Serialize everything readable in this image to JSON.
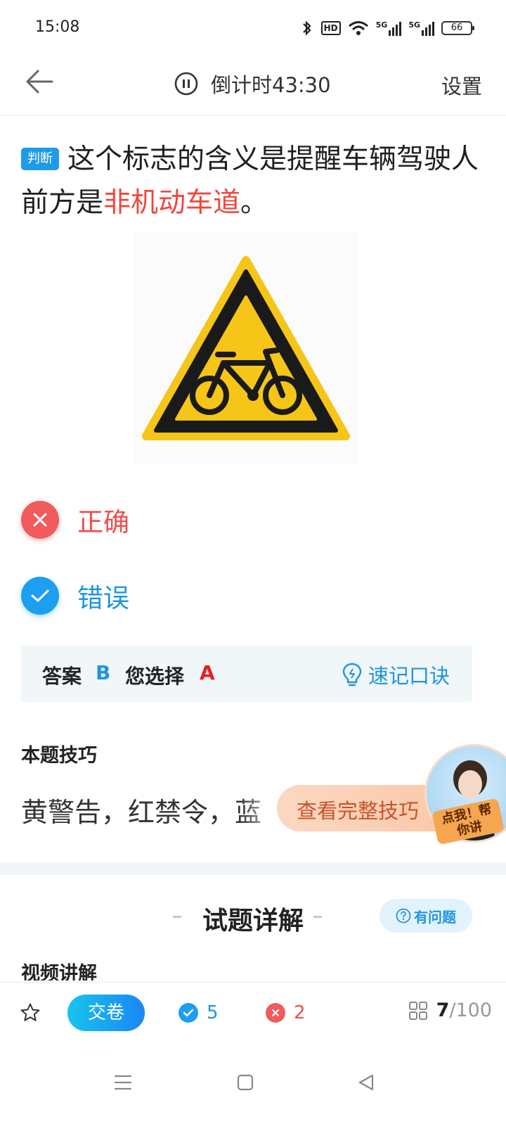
{
  "status_bar": {
    "time": "15:08",
    "hd_label": "HD",
    "signal_1_label": "5G",
    "signal_2_label": "5G",
    "battery": "66"
  },
  "nav": {
    "timer_text": "倒计时43:30",
    "settings_label": "设置"
  },
  "question": {
    "tag": "判断",
    "text_before": "这个标志的含义是提醒车辆驾驶人前方是",
    "text_highlight": "非机动车道",
    "text_after": "。",
    "highlight_color": "#f0473e"
  },
  "options": [
    {
      "label": "正确",
      "state": "wrong-selected",
      "icon": "close-icon",
      "color": "#f25b5b"
    },
    {
      "label": "错误",
      "state": "correct",
      "icon": "check-icon",
      "color": "#1d9ef0"
    }
  ],
  "answer": {
    "answer_label": "答案",
    "answer_value": "B",
    "selected_label": "您选择",
    "selected_value": "A",
    "memo_label": "速记口诀"
  },
  "tips": {
    "title": "本题技巧",
    "text": "黄警告，红禁令，蓝",
    "button_label": "查看完整技巧",
    "avatar_badge": "点我！帮你讲"
  },
  "detail": {
    "title": "试题详解",
    "report_label": "有问题",
    "video_title": "视频讲解"
  },
  "bottom_bar": {
    "submit_label": "交卷",
    "correct_count": "5",
    "wrong_count": "2",
    "current": "7",
    "total": "/100"
  },
  "colors": {
    "accent_blue": "#1d95e3",
    "error_red": "#ec4f4f",
    "sign_yellow": "#f5c518"
  }
}
